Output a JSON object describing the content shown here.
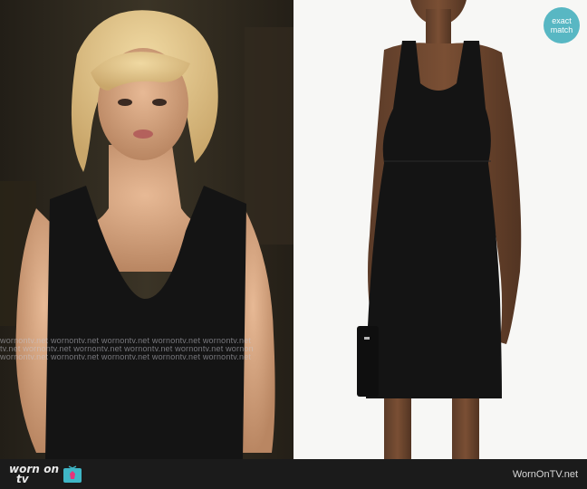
{
  "watermark": {
    "rows": [
      "wornontv.net  wornontv.net  wornontv.net  wornontv.net  wornontv.net",
      "tv.net  wornontv.net  wornontv.net  wornontv.net  wornontv.net  wornon",
      "wornontv.net  wornontv.net  wornontv.net  wornontv.net  wornontv.net"
    ]
  },
  "badge": {
    "line1": "exact",
    "line2": "match"
  },
  "footer": {
    "logo_word1": "worn",
    "logo_on": "on",
    "logo_word2": "tv",
    "site_name": "WornOnTV.net"
  },
  "colors": {
    "badge": "#58b7c3",
    "footer_bg": "#1b1b1b",
    "logo_pink": "#e6337a",
    "logo_teal": "#3fb6c6",
    "dress": "#141414"
  }
}
